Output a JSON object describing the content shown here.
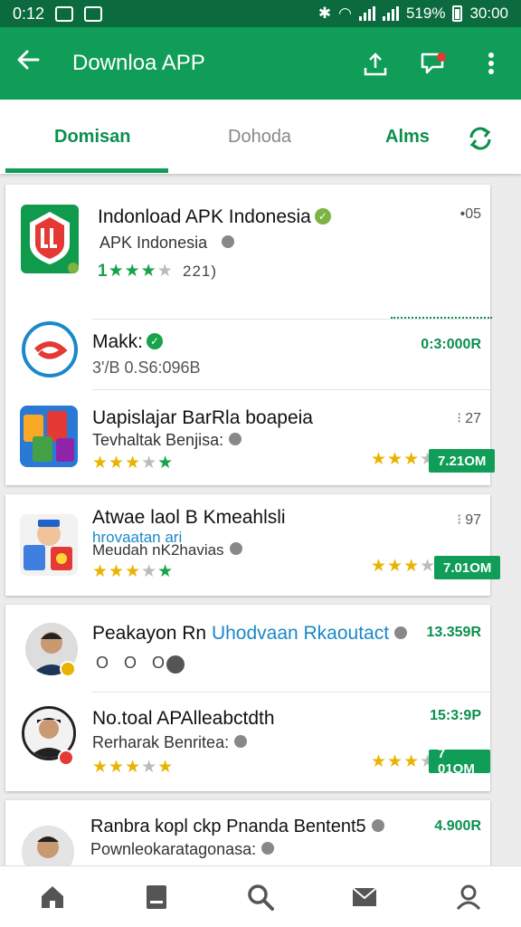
{
  "status_bar": {
    "time": "0:12",
    "battery": "519%",
    "clock_right": "30:00"
  },
  "app_bar": {
    "title": "Downloa APP"
  },
  "tabs": [
    {
      "label": "Domisan"
    },
    {
      "label": "Dohoda"
    },
    {
      "label": "Alms"
    }
  ],
  "featured": {
    "title": "Indonload APK Indonesia",
    "subtitle": "APK Indonesia",
    "rating_text": "1",
    "rating_count": "221)",
    "meta": "•05"
  },
  "items": [
    {
      "title": "Makk:",
      "subtitle": "3'/B 0.S6:096B",
      "size": "0:3:000R"
    },
    {
      "title": "Uapislajar BarRla boapeia",
      "subtitle": "Tevhaltak Benjisa:",
      "meta": "27",
      "size": "7.21OM",
      "stars_filled": 3,
      "stars_green": 1
    },
    {
      "title": "Atwae laol B Kmeahlsli",
      "subtitle2": "hrovaatan ari",
      "subtitle": "Meudah nK2havias",
      "meta": "97",
      "size": "7.01OM",
      "stars_filled": 3,
      "stars_green": 1
    },
    {
      "title": "Peakayon Rn",
      "title_blue": "Uhodvaan Rkaoutact",
      "size": "13.359R",
      "badges": "O O O"
    },
    {
      "title": "No.toal APAlleabctdth",
      "subtitle": "Rerharak Benritea:",
      "size": "15:3:9P",
      "pill": "7 01OM",
      "stars_filled": 3
    },
    {
      "title": "Ranbra kopl ckp Pnanda Bentent5",
      "subtitle": "Pownleokaratagonasa:",
      "size": "4.900R"
    }
  ],
  "colors": {
    "primary": "#0f9d58",
    "status": "#0b6b3f",
    "accent_green": "#0b8f4d",
    "star": "#e8b400"
  },
  "icons": [
    "back-arrow-icon",
    "share-icon",
    "notification-icon",
    "more-icon",
    "refresh-icon",
    "home-icon",
    "library-icon",
    "search-icon",
    "mail-icon",
    "profile-icon"
  ]
}
